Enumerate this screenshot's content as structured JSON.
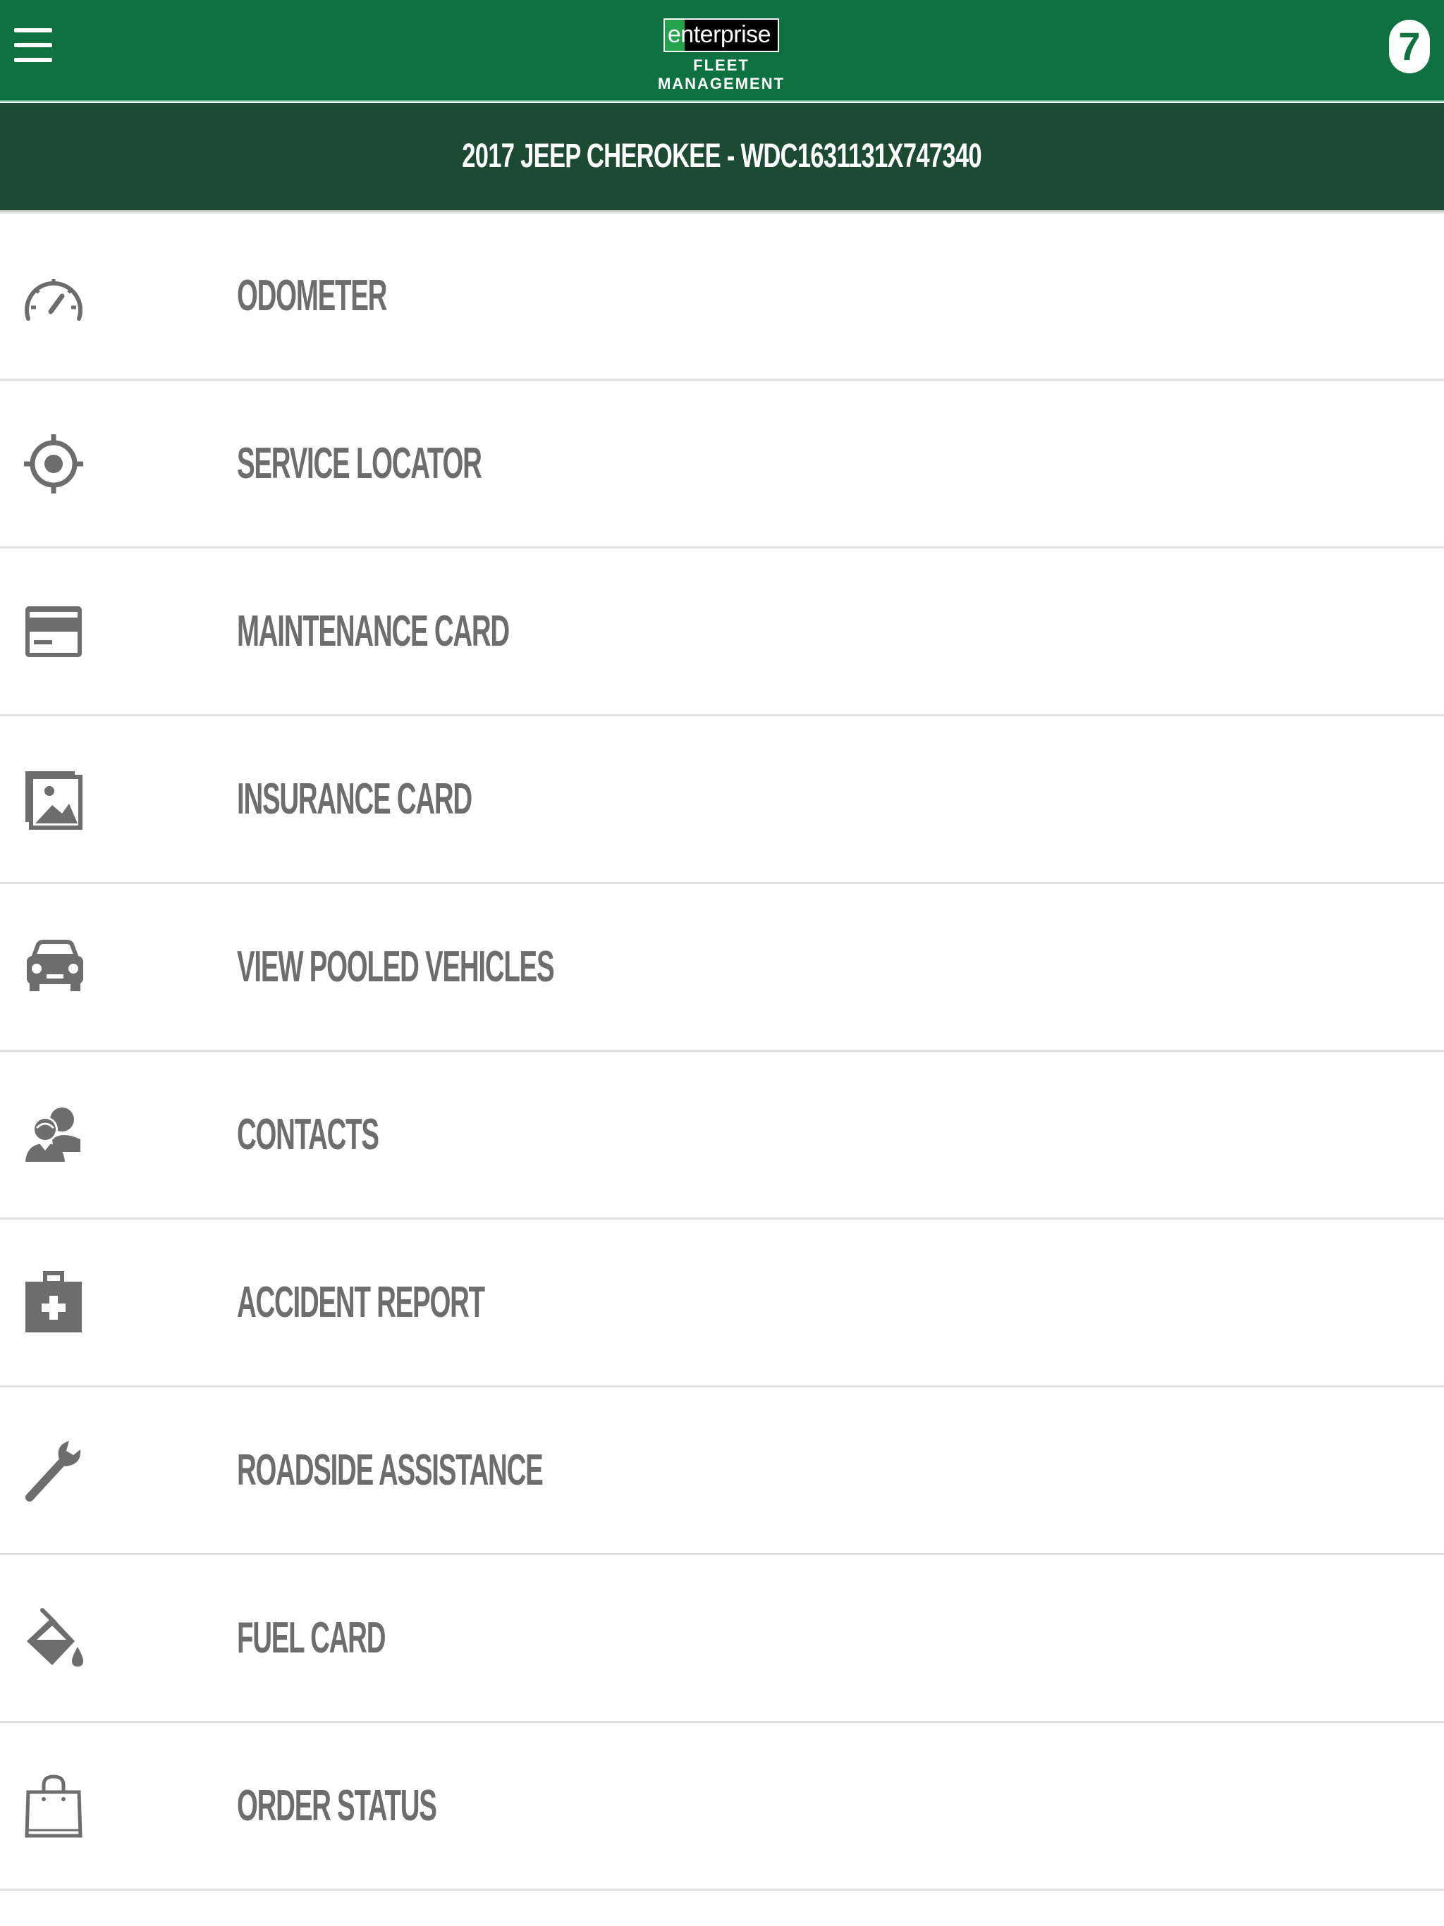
{
  "header": {
    "logo_text": "enterprise",
    "logo_subtext": "FLEET MANAGEMENT",
    "badge_count": "7",
    "brand_color": "#0e7140"
  },
  "vehicle": {
    "title": "2017 JEEP CHEROKEE - WDC1631131X747340"
  },
  "menu": {
    "items": [
      {
        "label": "ODOMETER",
        "icon": "speedometer-icon"
      },
      {
        "label": "SERVICE LOCATOR",
        "icon": "location-target-icon"
      },
      {
        "label": "MAINTENANCE CARD",
        "icon": "credit-card-icon"
      },
      {
        "label": "INSURANCE CARD",
        "icon": "image-card-icon"
      },
      {
        "label": "VIEW POOLED VEHICLES",
        "icon": "car-icon"
      },
      {
        "label": "CONTACTS",
        "icon": "contacts-icon"
      },
      {
        "label": "ACCIDENT REPORT",
        "icon": "first-aid-kit-icon"
      },
      {
        "label": "ROADSIDE ASSISTANCE",
        "icon": "wrench-icon"
      },
      {
        "label": "FUEL CARD",
        "icon": "fuel-bucket-icon"
      },
      {
        "label": "ORDER STATUS",
        "icon": "shopping-bag-icon"
      }
    ]
  }
}
